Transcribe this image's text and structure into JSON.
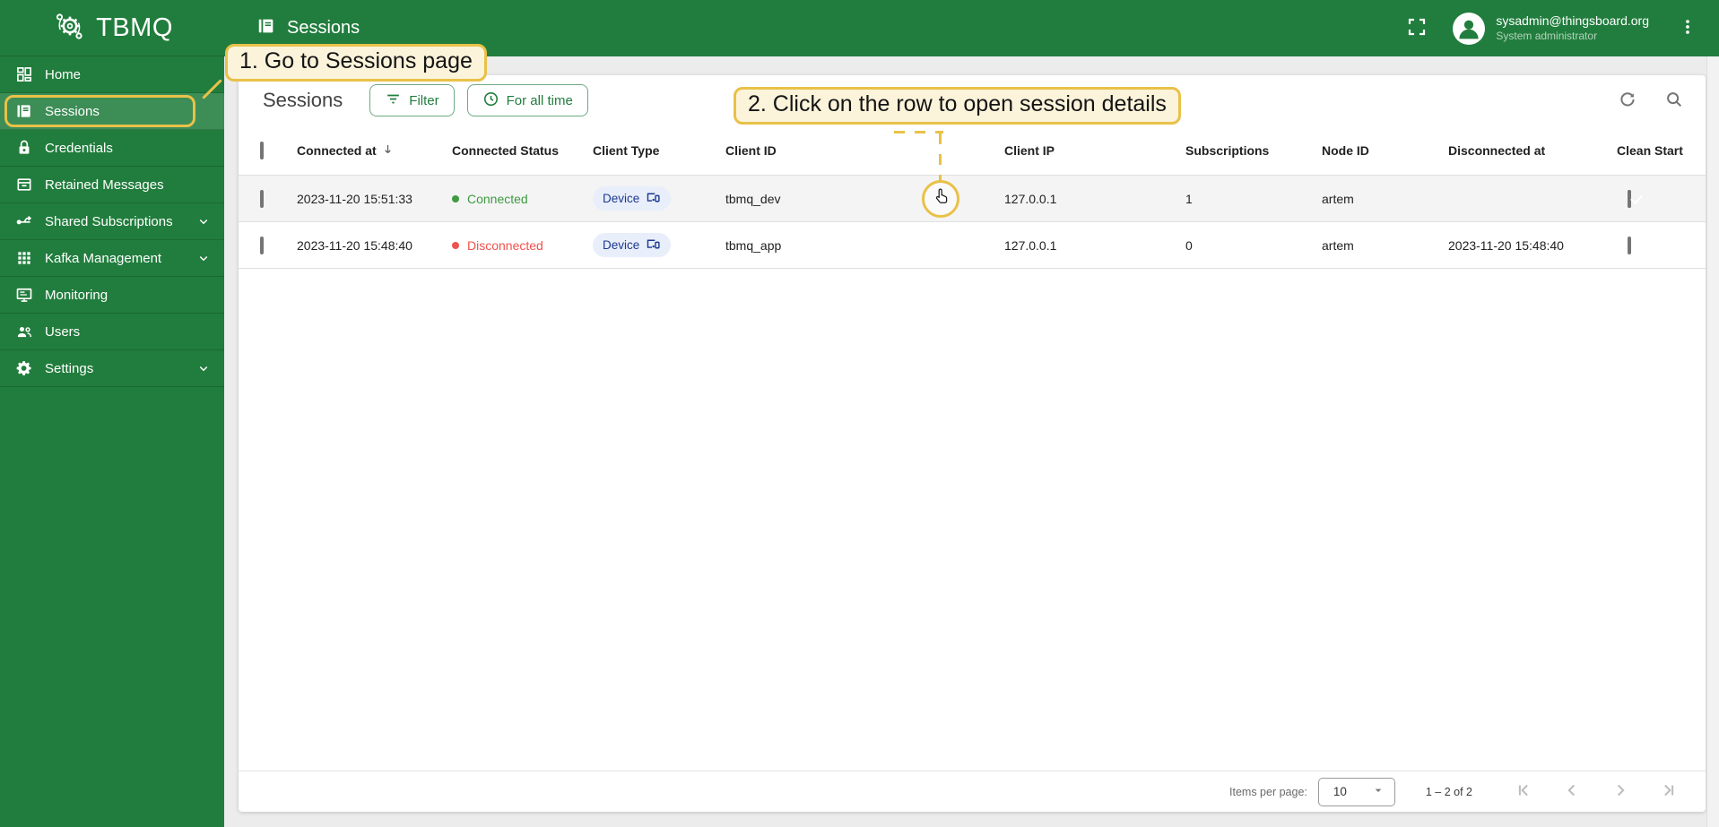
{
  "brand": {
    "name": "TBMQ"
  },
  "sidebar": {
    "items": [
      {
        "label": "Home",
        "icon": "dashboard-icon",
        "selected": false,
        "expandable": false
      },
      {
        "label": "Sessions",
        "icon": "sessions-book-icon",
        "selected": true,
        "expandable": false
      },
      {
        "label": "Credentials",
        "icon": "lock-icon",
        "selected": false,
        "expandable": false
      },
      {
        "label": "Retained Messages",
        "icon": "archive-icon",
        "selected": false,
        "expandable": false
      },
      {
        "label": "Shared Subscriptions",
        "icon": "branch-icon",
        "selected": false,
        "expandable": true
      },
      {
        "label": "Kafka Management",
        "icon": "apps-grid-icon",
        "selected": false,
        "expandable": true
      },
      {
        "label": "Monitoring",
        "icon": "monitor-icon",
        "selected": false,
        "expandable": false
      },
      {
        "label": "Users",
        "icon": "people-icon",
        "selected": false,
        "expandable": false
      },
      {
        "label": "Settings",
        "icon": "gear-icon",
        "selected": false,
        "expandable": true
      }
    ]
  },
  "topbar": {
    "title": "Sessions",
    "user": {
      "email": "sysadmin@thingsboard.org",
      "role": "System administrator"
    }
  },
  "annotations": {
    "step1": "1. Go to Sessions page",
    "step2": "2. Click on the row to open session details"
  },
  "content": {
    "title": "Sessions",
    "filter_label": "Filter",
    "time_label": "For all time"
  },
  "table": {
    "columns": [
      "",
      "Connected at",
      "Connected Status",
      "Client Type",
      "Client ID",
      "Client IP",
      "Subscriptions",
      "Node ID",
      "Disconnected at",
      "Clean Start"
    ],
    "sort_column": "Connected at",
    "sort_direction": "desc",
    "rows": [
      {
        "connected_at": "2023-11-20 15:51:33",
        "status": "Connected",
        "client_type": "Device",
        "client_id": "tbmq_dev",
        "client_ip": "127.0.0.1",
        "subscriptions": "1",
        "node_id": "artem",
        "disconnected_at": "",
        "clean_start": true,
        "hovered": true
      },
      {
        "connected_at": "2023-11-20 15:48:40",
        "status": "Disconnected",
        "client_type": "Device",
        "client_id": "tbmq_app",
        "client_ip": "127.0.0.1",
        "subscriptions": "0",
        "node_id": "artem",
        "disconnected_at": "2023-11-20 15:48:40",
        "clean_start": false,
        "hovered": false
      }
    ]
  },
  "footer": {
    "items_per_page_label": "Items per page:",
    "items_per_page": "10",
    "range": "1 – 2 of 2"
  },
  "colors": {
    "brand_green": "#217d3d",
    "annotation_yellow": "#e9c148",
    "annotation_bg": "#fbf3da",
    "connected": "#3d9b41",
    "disconnected": "#f0524d",
    "chip_bg": "#e9eefb",
    "chip_text": "#1b3a8f"
  }
}
